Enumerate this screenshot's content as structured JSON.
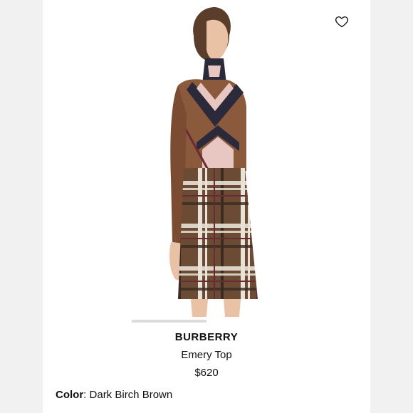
{
  "product": {
    "brand": "BURBERRY",
    "name": "Emery Top",
    "price": "$620",
    "color_label": "Color",
    "color_separator": ": ",
    "color_value": "Dark Birch Brown"
  },
  "gallery": {
    "image_index_fraction": 0.25
  },
  "icons": {
    "wishlist": "heart-outline-icon"
  },
  "colors": {
    "top_brown": "#8b5a3c",
    "chevron_navy": "#2b2a3a",
    "chevron_pink": "#e8c7c2",
    "skirt_brown": "#6b4b34",
    "plaid_cream": "#e9e2d6",
    "plaid_wine": "#6a2a35"
  }
}
